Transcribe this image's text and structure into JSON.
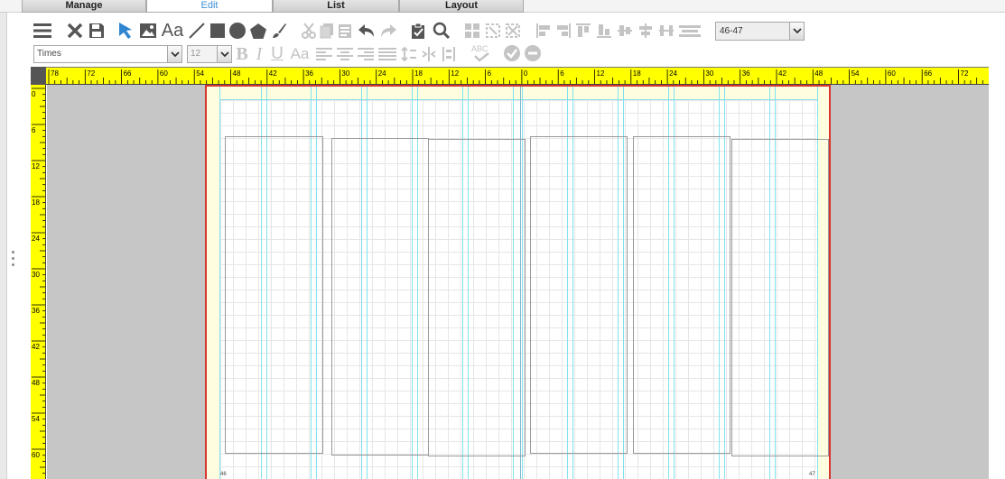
{
  "tabs": [
    {
      "label": "Manage"
    },
    {
      "label": "Edit"
    },
    {
      "label": "List"
    },
    {
      "label": "Layout"
    }
  ],
  "toolbar": {
    "font_family_value": "Times",
    "font_size_value": "12",
    "page_select_value": "46-47",
    "text_tool_label": "Aa",
    "icons": [
      "menu-icon",
      "close-icon",
      "save-icon",
      "select-arrow-icon",
      "image-icon",
      "text-icon",
      "line-icon",
      "rectangle-icon",
      "circle-icon",
      "polygon-icon",
      "brush-icon",
      "cut-icon",
      "copy-icon",
      "paste-icon",
      "undo-icon",
      "redo-icon",
      "clipboard-icon",
      "search-icon",
      "group-icon",
      "ungroup-icon",
      "delete-group-icon",
      "align-left-icon",
      "align-center-icon",
      "align-top-icon",
      "align-bottom-icon",
      "align-middle-icon",
      "distribute-icon",
      "distribute-horizontal-icon",
      "bold-icon",
      "italic-icon",
      "underline-icon",
      "text-style-icon",
      "paragraph-left-icon",
      "paragraph-center-icon",
      "paragraph-right-icon",
      "paragraph-justify-icon",
      "spacing-icon",
      "line-spacing-icon",
      "column-spacing-icon",
      "spellcheck-icon",
      "approve-icon",
      "reject-icon"
    ],
    "format_labels": {
      "bold": "B",
      "italic": "I",
      "underline": "U",
      "text_style": "Aa",
      "spell": "ABC"
    }
  },
  "rulers": {
    "horizontal_labels": [
      "78",
      "72",
      "66",
      "60",
      "54",
      "48",
      "42",
      "36",
      "30",
      "24",
      "18",
      "12",
      "6",
      "0",
      "6",
      "12",
      "18",
      "24",
      "30",
      "36",
      "42",
      "48",
      "54",
      "60",
      "66",
      "72"
    ],
    "vertical_labels": [
      "0",
      "6",
      "12",
      "18",
      "24",
      "30",
      "36",
      "42",
      "48",
      "54",
      "60"
    ]
  },
  "spread": {
    "left_page_number": "46",
    "right_page_number": "47"
  },
  "colors": {
    "ruler": "#ffff00",
    "spread_border": "#d9352f",
    "guide": "#7fe3ef",
    "canvas_bg": "#c6c6c6",
    "active_tab_text": "#3a8fd4"
  }
}
